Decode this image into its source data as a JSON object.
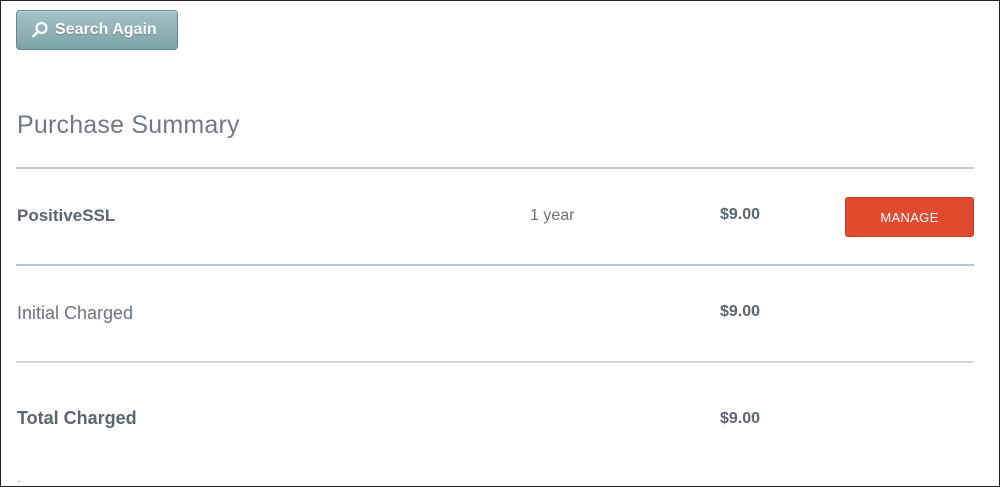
{
  "search_again": {
    "label": "Search Again",
    "icon": "search-icon"
  },
  "summary": {
    "title": "Purchase Summary",
    "items": [
      {
        "name": "PositiveSSL",
        "term": "1 year",
        "price": "$9.00",
        "action_label": "MANAGE"
      }
    ],
    "initial": {
      "label": "Initial Charged",
      "amount": "$9.00"
    },
    "total": {
      "label": "Total Charged",
      "amount": "$9.00"
    }
  },
  "colors": {
    "manage_button": "#e04a2f",
    "search_button": "#8fb1b5",
    "divider": "#b8c8d0",
    "text": "#5c6670"
  }
}
